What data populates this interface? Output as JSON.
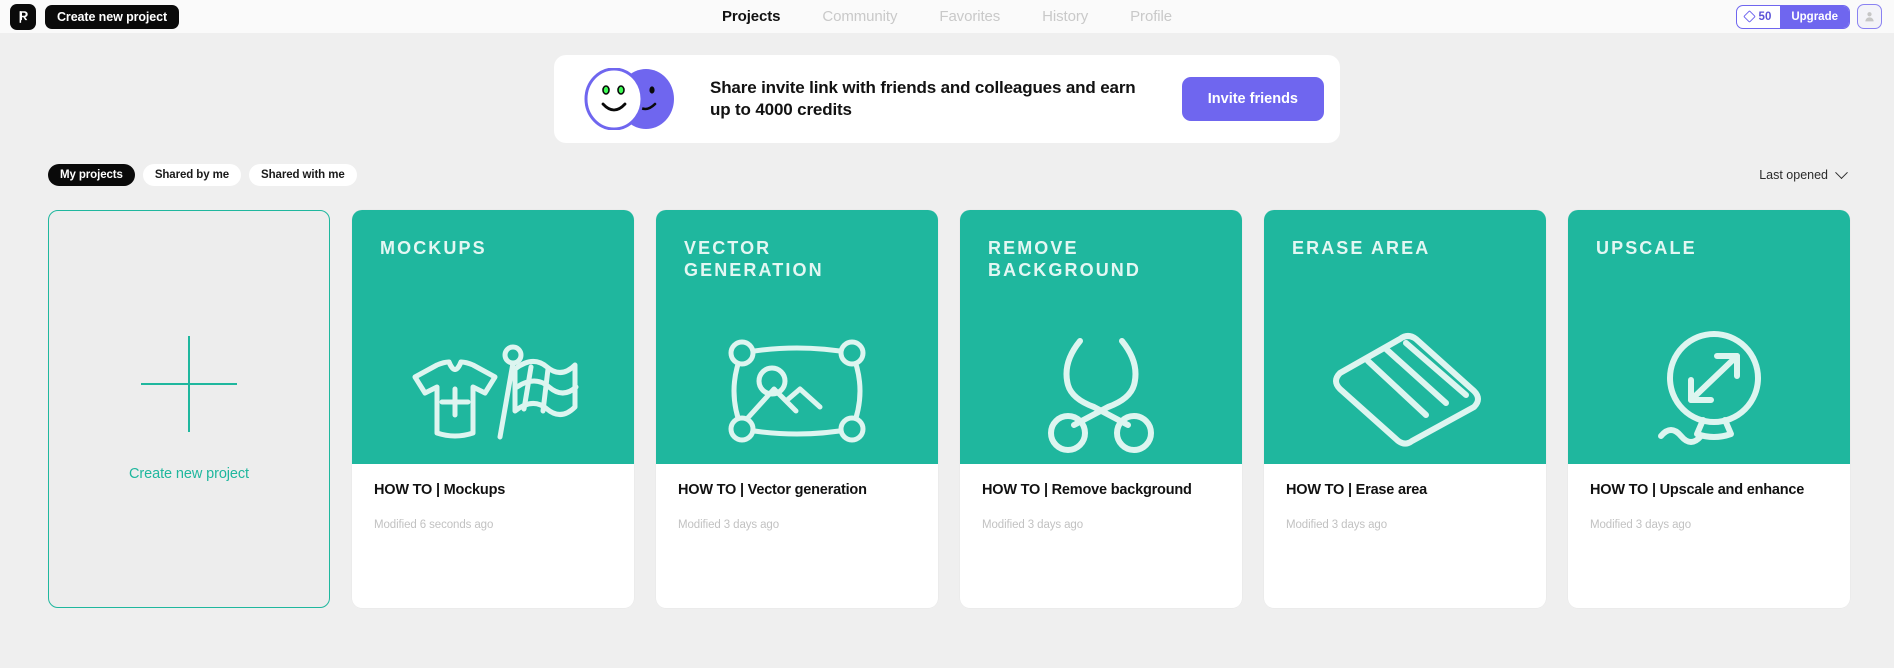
{
  "topbar": {
    "logo_icon": "app-logo-r",
    "create_project_label": "Create new project",
    "nav": [
      {
        "label": "Projects",
        "active": true
      },
      {
        "label": "Community",
        "active": false
      },
      {
        "label": "Favorites",
        "active": false
      },
      {
        "label": "History",
        "active": false
      },
      {
        "label": "Profile",
        "active": false
      }
    ],
    "credits_value": "50",
    "credits_icon": "diamond-icon",
    "upgrade_label": "Upgrade",
    "avatar_icon": "user-avatar-icon"
  },
  "banner": {
    "text": "Share invite link with friends and colleagues and earn up to 4000 credits",
    "button_label": "Invite friends",
    "illustration": "two-smiley-faces"
  },
  "filters": {
    "pills": [
      {
        "label": "My projects",
        "active": true
      },
      {
        "label": "Shared by me",
        "active": false
      },
      {
        "label": "Shared with me",
        "active": false
      }
    ],
    "sort_label": "Last opened",
    "sort_icon": "chevron-down-icon"
  },
  "new_project_card": {
    "label": "Create new project",
    "icon": "plus-icon"
  },
  "projects": [
    {
      "thumb_title": "MOCKUPS",
      "title": "HOW TO | Mockups",
      "meta": "Modified 6 seconds ago",
      "icon": "tshirt-and-flag-icon"
    },
    {
      "thumb_title": "VECTOR\nGENERATION",
      "title": "HOW TO | Vector generation",
      "meta": "Modified 3 days ago",
      "icon": "vector-image-nodes-icon"
    },
    {
      "thumb_title": "REMOVE\nBACKGROUND",
      "title": "HOW TO | Remove background",
      "meta": "Modified 3 days ago",
      "icon": "scissors-icon"
    },
    {
      "thumb_title": "ERASE AREA",
      "title": "HOW TO | Erase area",
      "meta": "Modified 3 days ago",
      "icon": "eraser-icon"
    },
    {
      "thumb_title": "UPSCALE",
      "title": "HOW TO | Upscale and enhance",
      "meta": "Modified 3 days ago",
      "icon": "balloon-expand-icon"
    }
  ],
  "colors": {
    "teal": "#1fb79e",
    "purple": "#6f66ef",
    "black": "#0a0a0a",
    "page_bg": "#efefef"
  }
}
